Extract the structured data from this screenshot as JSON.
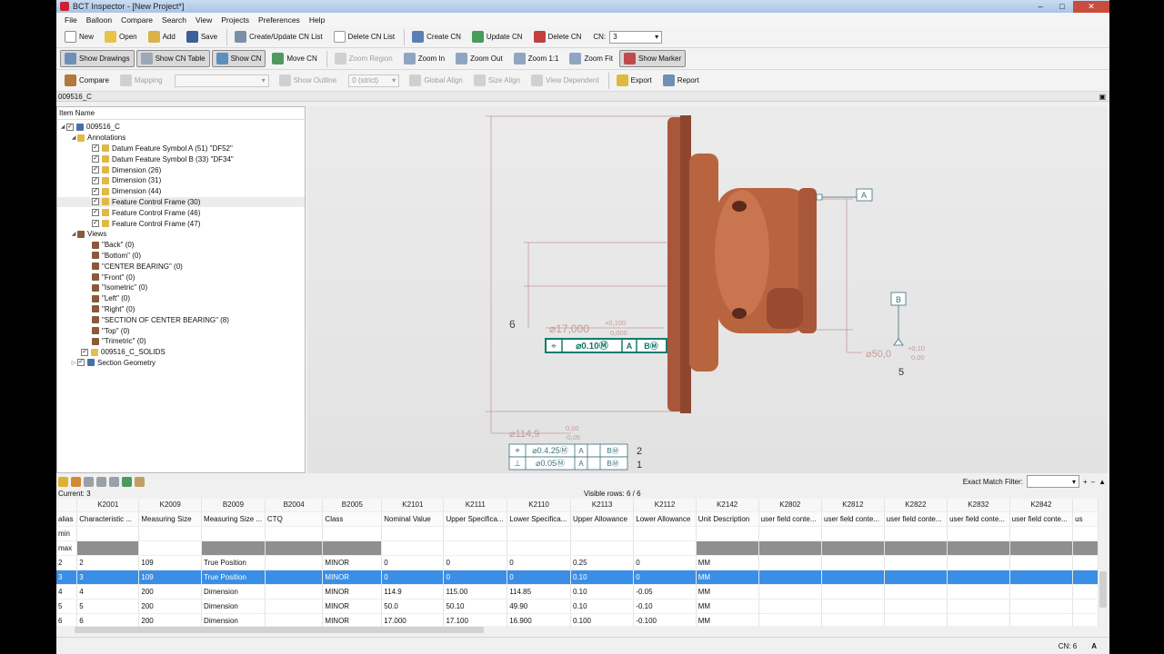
{
  "window": {
    "title": "BCT Inspector - [New Project*]",
    "controls": [
      "–",
      "□",
      "✕"
    ]
  },
  "menu": [
    "File",
    "Balloon",
    "Compare",
    "Search",
    "View",
    "Projects",
    "Preferences",
    "Help"
  ],
  "toolbar1": {
    "new": "New",
    "open": "Open",
    "add": "Add",
    "save": "Save",
    "create_update_cn_list": "Create/Update CN List",
    "delete_cn_list": "Delete CN List",
    "create_cn": "Create CN",
    "update_cn": "Update CN",
    "delete_cn": "Delete CN",
    "cn_label": "CN:",
    "cn_value": "3"
  },
  "toolbar2": {
    "show_drawings": "Show Drawings",
    "show_cn_table": "Show CN Table",
    "show_cn": "Show CN",
    "move_cn": "Move CN",
    "zoom_region": "Zoom Region",
    "zoom_in": "Zoom In",
    "zoom_out": "Zoom Out",
    "zoom_1_1": "Zoom 1:1",
    "zoom_fit": "Zoom Fit",
    "show_marker": "Show Marker"
  },
  "toolbar3": {
    "compare": "Compare",
    "mapping": "Mapping",
    "mapping_value": "",
    "show_outline": "Show Outline",
    "outline_value": "0 (strict)",
    "global_align": "Global Align",
    "size_align": "Size Align",
    "view_dependent": "View Dependent",
    "export": "Export",
    "report": "Report"
  },
  "path": "009516_C",
  "tree": {
    "header": "Item Name",
    "root": "009516_C",
    "annotations": "Annotations",
    "annotation_items": [
      "Datum Feature Symbol A (51) \"DF52\"",
      "Datum Feature Symbol B (33) \"DF34\"",
      "Dimension (26)",
      "Dimension (31)",
      "Dimension (44)",
      "Feature Control Frame (30)",
      "Feature Control Frame (46)",
      "Feature Control Frame (47)"
    ],
    "views": "Views",
    "view_items": [
      "\"Back\" (0)",
      "\"Bottom\" (0)",
      "\"CENTER BEARING\" (0)",
      "\"Front\" (0)",
      "\"Isometric\" (0)",
      "\"Left\" (0)",
      "\"Right\" (0)",
      "\"SECTION OF CENTER BEARING\" (8)",
      "\"Top\" (0)",
      "\"Trimetric\" (0)"
    ],
    "solids": "009516_C_SOLIDS",
    "section_geometry": "Section Geometry"
  },
  "drawing": {
    "balloon_6": "6",
    "dim_17": "⌀17,000",
    "dim_17_tol_upper": "+0,100",
    "dim_17_tol_lower": "0,000",
    "fcf_30_symbol": "⌖",
    "fcf_30_tol": "⌀0.10Ⓜ",
    "fcf_30_a": "A",
    "fcf_30_b": "BⓂ",
    "datum_a": "A",
    "datum_b": "B",
    "dim_50": "⌀50,0",
    "dim_50_tol_upper": "+0,10",
    "dim_50_tol_lower": "0,00",
    "balloon_5": "5",
    "dim_114": "⌀114,9",
    "dim_114_tol_upper": "0,00",
    "dim_114_tol_lower": "-0,05",
    "fcf_row1_symbol": "⌖",
    "fcf_row1_tol": "⌀0.4.25Ⓜ",
    "fcf_row1_a": "A",
    "fcf_row1_b": "BⓂ",
    "balloon_2": "2",
    "fcf_row2_symbol": "⊥",
    "fcf_row2_tol": "⌀0.05Ⓜ",
    "fcf_row2_a": "A",
    "fcf_row2_b": "BⓂ",
    "balloon_1": "1",
    "colors": {
      "part": "#b8653f",
      "dim": "#c49a9a",
      "frame": "#3d6f7a",
      "fcf_highlight": "#147a6c"
    }
  },
  "grid": {
    "exact_match_filter": "Exact Match Filter:",
    "current": "Current: 3",
    "visible_rows": "Visible rows: 6 / 6",
    "codes": [
      "",
      "K2001",
      "K2009",
      "B2009",
      "B2004",
      "B2005",
      "K2101",
      "K2111",
      "K2110",
      "K2113",
      "K2112",
      "K2142",
      "K2802",
      "K2812",
      "K2822",
      "K2832",
      "K2842"
    ],
    "headers": [
      "alias",
      "Characteristic ...",
      "Measuring Size",
      "Measuring Size ...",
      "CTQ",
      "Class",
      "Nominal Value",
      "Upper Specifica...",
      "Lower Specifica...",
      "Upper Allowance",
      "Lower Allowance",
      "Unit Description",
      "user field conte...",
      "user field conte...",
      "user field conte...",
      "user field conte...",
      "user field conte...",
      "us"
    ],
    "min_label": "min",
    "max_label": "max",
    "rows": [
      [
        "2",
        "2",
        "109",
        "True Position",
        "",
        "MINOR",
        "0",
        "0",
        "0",
        "0.25",
        "0",
        "MM",
        "",
        "",
        "",
        "",
        "",
        ""
      ],
      [
        "3",
        "3",
        "109",
        "True Position",
        "",
        "MINOR",
        "0",
        "0",
        "0",
        "0.10",
        "0",
        "MM",
        "",
        "",
        "",
        "",
        "",
        ""
      ],
      [
        "4",
        "4",
        "200",
        "Dimension",
        "",
        "MINOR",
        "114.9",
        "115.00",
        "114.85",
        "0.10",
        "-0.05",
        "MM",
        "",
        "",
        "",
        "",
        "",
        ""
      ],
      [
        "5",
        "5",
        "200",
        "Dimension",
        "",
        "MINOR",
        "50.0",
        "50.10",
        "49.90",
        "0.10",
        "-0.10",
        "MM",
        "",
        "",
        "",
        "",
        "",
        ""
      ],
      [
        "6",
        "6",
        "200",
        "Dimension",
        "",
        "MINOR",
        "17.000",
        "17.100",
        "16.900",
        "0.100",
        "-0.100",
        "MM",
        "",
        "",
        "",
        "",
        "",
        ""
      ]
    ],
    "selected_row": 1
  },
  "status": {
    "cn": "CN: 6",
    "mode": "A"
  }
}
